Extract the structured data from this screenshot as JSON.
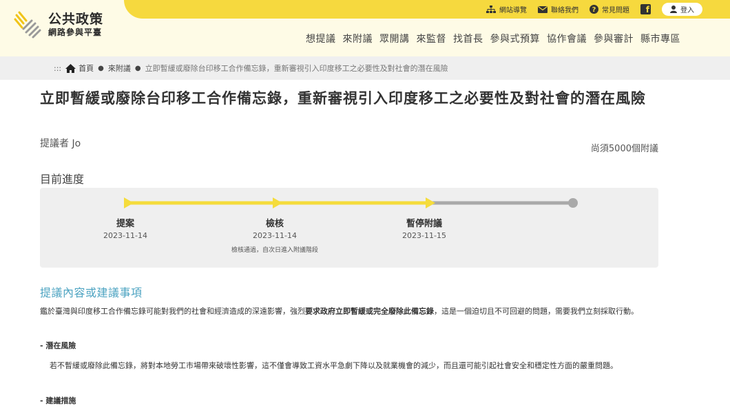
{
  "site": {
    "title": "公共政策",
    "subtitle": "網路參與平臺"
  },
  "top_links": {
    "sitemap": "網站導覽",
    "contact": "聯絡我們",
    "faq": "常見問題",
    "facebook": "f",
    "login": "登入"
  },
  "nav": [
    "想提議",
    "來附議",
    "眾開講",
    "來監督",
    "找首長",
    "參與式預算",
    "協作會議",
    "參與審計",
    "縣市專區"
  ],
  "breadcrumb": {
    "marker": ":::",
    "home": "首頁",
    "section": "來附議",
    "current": "立即暫緩或廢除台印移工合作備忘錄，重新審視引入印度移工之必要性及對社會的潛在風險"
  },
  "proposal": {
    "title": "立即暫緩或廢除台印移工合作備忘錄，重新審視引入印度移工之必要性及對社會的潛在風險",
    "proposer": "提議者 Jo",
    "remaining": "尚須5000個附議"
  },
  "progress": {
    "heading": "目前進度",
    "steps": [
      {
        "label": "提案",
        "date": "2023-11-14",
        "note": ""
      },
      {
        "label": "檢核",
        "date": "2023-11-14",
        "note": "檢核通過，自次日進入附議階段"
      },
      {
        "label": "暫停附議",
        "date": "2023-11-15",
        "note": ""
      }
    ],
    "completed_fraction": 0.68,
    "colors": {
      "done": "#f5dc3c",
      "pending": "#a9a9a9"
    }
  },
  "content": {
    "heading": "提議內容或建議事項",
    "p1_a": "鑑於臺灣與印度移工合作備忘錄可能對我們的社會和經濟造成的深遠影響，強烈",
    "p1_b": "要求政府立即暫緩或完全廢除此備忘錄",
    "p1_c": "，這是一個迫切且不可回避的問題，需要我們立刻採取行動。",
    "risk_heading": "- 潛在風險",
    "risk_text": "若不暫緩或廢除此備忘錄，將對本地勞工市場帶來破壞性影響，這不僅會導致工資水平急劇下降以及就業機會的減少，而且還可能引起社會安全和穩定性方面的嚴重問題。",
    "measures_heading": "- 建議措施"
  },
  "colors": {
    "accent": "#f6d93e",
    "link": "#4ea4c2",
    "header_bg": "#fefbe6"
  }
}
